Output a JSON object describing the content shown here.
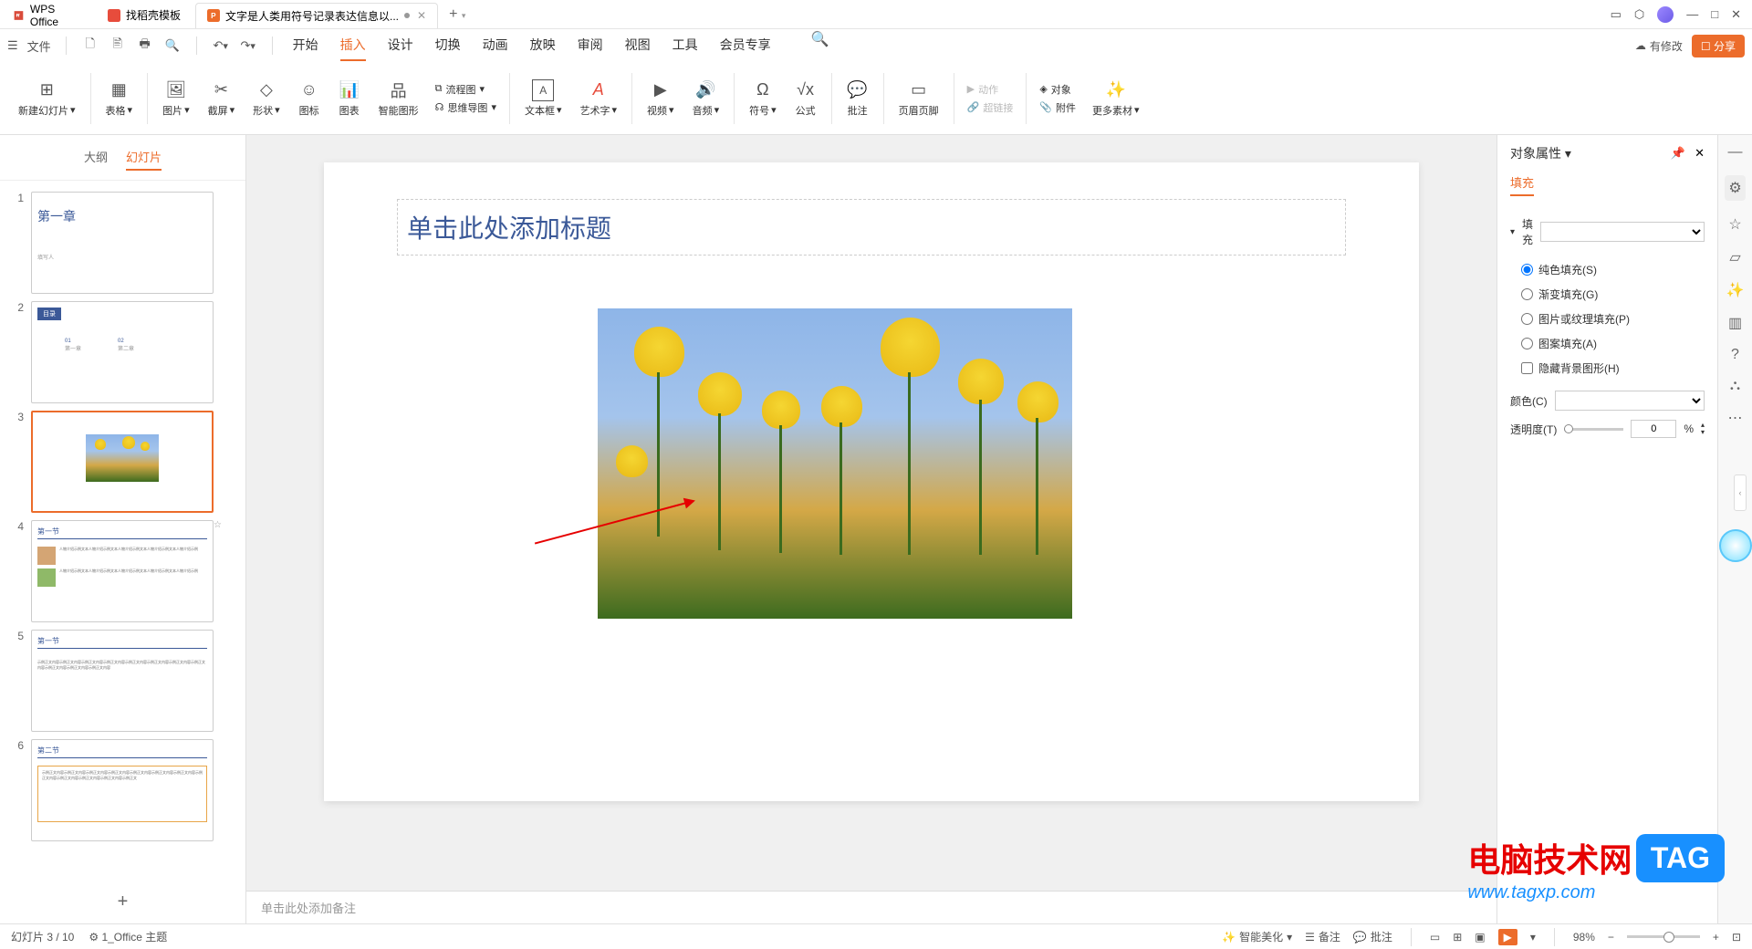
{
  "titlebar": {
    "tabs": [
      {
        "label": "WPS Office"
      },
      {
        "label": "找稻壳模板"
      },
      {
        "label": "文字是人类用符号记录表达信息以..."
      }
    ],
    "newtab": "+",
    "controls": {
      "min": "—",
      "max": "□",
      "close": "✕"
    }
  },
  "menubar": {
    "file": "文件",
    "tabs": [
      "开始",
      "插入",
      "设计",
      "切换",
      "动画",
      "放映",
      "审阅",
      "视图",
      "工具",
      "会员专享"
    ],
    "active": "插入",
    "modify": "有修改",
    "share": "分享"
  },
  "ribbon": {
    "items": [
      {
        "label": "新建幻灯片",
        "icon": "⊞"
      },
      {
        "label": "表格",
        "icon": "▦"
      },
      {
        "label": "图片",
        "icon": "🖼"
      },
      {
        "label": "截屏",
        "icon": "✂"
      },
      {
        "label": "形状",
        "icon": "◇"
      },
      {
        "label": "图标",
        "icon": "☺"
      },
      {
        "label": "图表",
        "icon": "📊"
      },
      {
        "label": "智能图形",
        "icon": "品"
      },
      {
        "label": "文本框",
        "icon": "A"
      },
      {
        "label": "艺术字",
        "icon": "A"
      },
      {
        "label": "视频",
        "icon": "▶"
      },
      {
        "label": "音频",
        "icon": "🔊"
      },
      {
        "label": "符号",
        "icon": "Ω"
      },
      {
        "label": "公式",
        "icon": "√x"
      },
      {
        "label": "批注",
        "icon": "💬"
      },
      {
        "label": "页眉页脚",
        "icon": "▭"
      }
    ],
    "flow": "流程图",
    "mind": "思维导图",
    "action": "动作",
    "hyperlink": "超链接",
    "object": "对象",
    "attach": "附件",
    "more": "更多素材"
  },
  "slidepanel": {
    "tabs": {
      "outline": "大纲",
      "slides": "幻灯片"
    },
    "slides": [
      {
        "num": "1",
        "title": "第一章",
        "sub": "填写人"
      },
      {
        "num": "2",
        "title": "目录"
      },
      {
        "num": "3",
        "title": ""
      },
      {
        "num": "4",
        "title": "第一节"
      },
      {
        "num": "5",
        "title": "第一节"
      },
      {
        "num": "6",
        "title": "第二节"
      }
    ]
  },
  "canvas": {
    "title_placeholder": "单击此处添加标题",
    "notes_placeholder": "单击此处添加备注"
  },
  "rightpanel": {
    "title": "对象属性",
    "tab": "填充",
    "section": "填充",
    "options": {
      "solid": "纯色填充(S)",
      "gradient": "渐变填充(G)",
      "picture": "图片或纹理填充(P)",
      "pattern": "图案填充(A)",
      "hidebg": "隐藏背景图形(H)"
    },
    "color_label": "颜色(C)",
    "trans_label": "透明度(T)",
    "trans_value": "0",
    "trans_unit": "%"
  },
  "statusbar": {
    "page": "幻灯片 3 / 10",
    "theme": "1_Office 主题",
    "beautify": "智能美化",
    "notes": "备注",
    "comments": "批注",
    "zoom": "98%"
  },
  "watermark": {
    "text": "电脑技术网",
    "tag": "TAG",
    "url": "www.tagxp.com"
  }
}
